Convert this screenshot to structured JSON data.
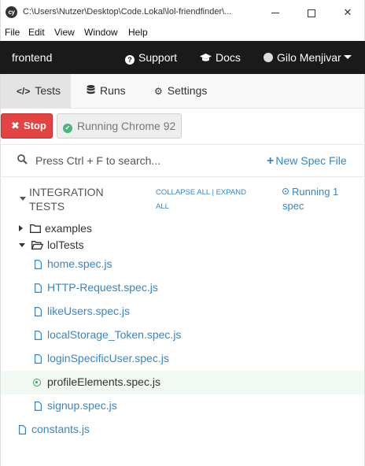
{
  "window": {
    "app_icon": "cy",
    "title": "C:\\Users\\Nutzer\\Desktop\\Code.Lokal\\lol-friendfinder\\..."
  },
  "menu": [
    "File",
    "Edit",
    "View",
    "Window",
    "Help"
  ],
  "topnav": {
    "project": "frontend",
    "support": "Support",
    "docs": "Docs",
    "user": "Gilo Menjivar"
  },
  "tabs": {
    "tests": "Tests",
    "runs": "Runs",
    "settings": "Settings",
    "active": "Tests"
  },
  "runbar": {
    "stop": "Stop",
    "browser": "Running Chrome 92"
  },
  "search": {
    "placeholder": "Press Ctrl + F to search...",
    "new_spec": "New Spec File"
  },
  "section": {
    "title": "INTEGRATION TESTS",
    "collapse_all": "COLLAPSE ALL",
    "separator": "|",
    "expand_all": "EXPAND ALL",
    "running": "Running 1 spec"
  },
  "tree": {
    "folders": [
      {
        "name": "examples",
        "expanded": false
      },
      {
        "name": "lolTests",
        "expanded": true
      }
    ],
    "specs": [
      {
        "name": "home.spec.js",
        "running": false
      },
      {
        "name": "HTTP-Request.spec.js",
        "running": false
      },
      {
        "name": "likeUsers.spec.js",
        "running": false
      },
      {
        "name": "localStorage_Token.spec.js",
        "running": false
      },
      {
        "name": "loginSpecificUser.spec.js",
        "running": false
      },
      {
        "name": "profileElements.spec.js",
        "running": true
      },
      {
        "name": "signup.spec.js",
        "running": false
      }
    ],
    "root_file": "constants.js"
  },
  "colors": {
    "accent": "#3486c8",
    "stop": "#e24343",
    "running": "#4db37e",
    "nav_bg": "#1a1a1a"
  },
  "icons": {
    "support": "question-circle-icon",
    "docs": "graduation-cap-icon",
    "user": "user-avatar-icon",
    "tests": "code-icon",
    "runs": "database-icon",
    "settings": "gear-icon",
    "search": "search-icon",
    "new_spec": "plus-icon",
    "spec_file": "file-icon",
    "running_spec": "dot-circle-icon"
  }
}
